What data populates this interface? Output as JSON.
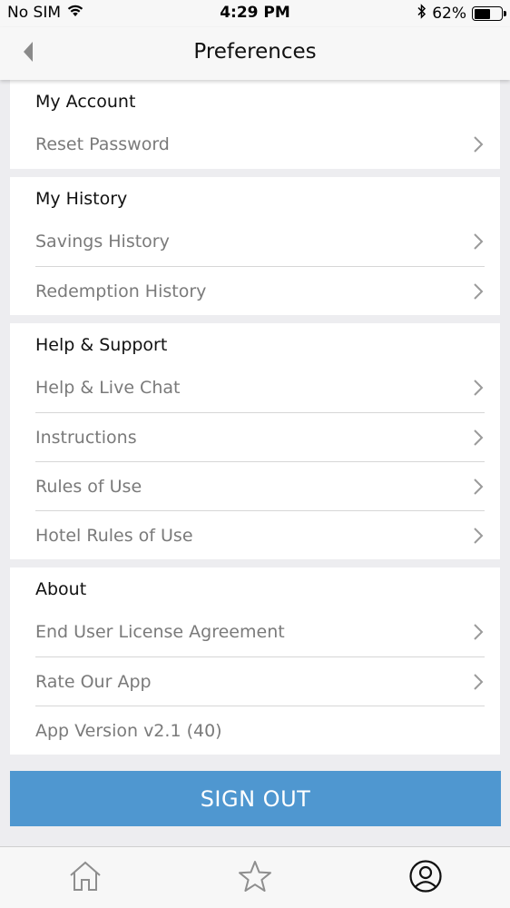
{
  "status_bar": {
    "carrier": "No SIM",
    "time": "4:29 PM",
    "battery": "62%",
    "battery_level": 0.62
  },
  "nav": {
    "title": "Preferences"
  },
  "sections": [
    {
      "title": "My Account",
      "items": [
        {
          "label": "Reset Password",
          "chevron": true
        }
      ]
    },
    {
      "title": "My History",
      "items": [
        {
          "label": "Savings History",
          "chevron": true
        },
        {
          "label": "Redemption History",
          "chevron": true
        }
      ]
    },
    {
      "title": "Help & Support",
      "items": [
        {
          "label": "Help & Live Chat",
          "chevron": true
        },
        {
          "label": "Instructions",
          "chevron": true
        },
        {
          "label": "Rules of Use",
          "chevron": true
        },
        {
          "label": "Hotel Rules of Use",
          "chevron": true
        }
      ]
    },
    {
      "title": "About",
      "items": [
        {
          "label": "End User License Agreement",
          "chevron": true
        },
        {
          "label": "Rate Our App",
          "chevron": true
        },
        {
          "label": "App Version v2.1 (40)",
          "chevron": false
        }
      ]
    }
  ],
  "sign_out_label": "SIGN OUT",
  "tabs": [
    {
      "icon": "home-icon",
      "active": false
    },
    {
      "icon": "star-icon",
      "active": false
    },
    {
      "icon": "profile-icon",
      "active": true
    }
  ],
  "colors": {
    "accent": "#4f97d0",
    "background": "#ededf0"
  }
}
